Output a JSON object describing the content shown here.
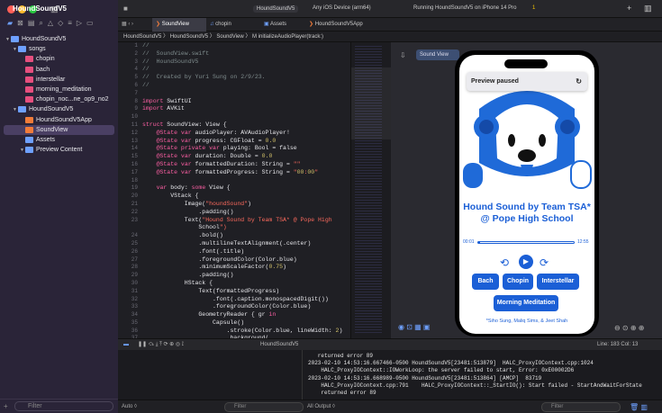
{
  "project_title": "HoundSoundV5",
  "toolbar": {
    "scheme": "HoundSoundV5",
    "device": "Any iOS Device (arm64)",
    "status": "Running HoundSoundV5 on iPhone 14 Pro",
    "warnings": "1"
  },
  "tabs": [
    "SoundView",
    "chopin",
    "Assets",
    "HoundSoundV5App"
  ],
  "breadcrumb": "HoundSoundV5 〉 HoundSoundV5 〉 SoundView 〉 M initializeAudioPlayer(track:)",
  "navigator": [
    {
      "label": "HoundSoundV5",
      "depth": 0,
      "kind": "project"
    },
    {
      "label": "songs",
      "depth": 1,
      "kind": "folder"
    },
    {
      "label": "chopin",
      "depth": 2,
      "kind": "audio"
    },
    {
      "label": "bach",
      "depth": 2,
      "kind": "audio"
    },
    {
      "label": "interstellar",
      "depth": 2,
      "kind": "audio"
    },
    {
      "label": "morning_meditation",
      "depth": 2,
      "kind": "audio"
    },
    {
      "label": "chopin_noc...ne_op9_no2",
      "depth": 2,
      "kind": "audio"
    },
    {
      "label": "HoundSoundV5",
      "depth": 1,
      "kind": "folder"
    },
    {
      "label": "HoundSoundV5App",
      "depth": 2,
      "kind": "swift"
    },
    {
      "label": "SoundView",
      "depth": 2,
      "kind": "swift",
      "selected": true
    },
    {
      "label": "Assets",
      "depth": 2,
      "kind": "assets"
    },
    {
      "label": "Preview Content",
      "depth": 2,
      "kind": "folder"
    }
  ],
  "line_numbers": [
    "1",
    "2",
    "3",
    "4",
    "5",
    "6",
    "7",
    "8",
    "9",
    "10",
    "11",
    "12",
    "13",
    "14",
    "15",
    "16",
    "17",
    "18",
    "19",
    "20",
    "21",
    "22",
    "23",
    "",
    "24",
    "25",
    "26",
    "27",
    "28",
    "29",
    "30",
    "31",
    "32",
    "33",
    "34",
    "35",
    "36",
    "37"
  ],
  "code_lines": [
    "//",
    "//  SoundView.swift",
    "//  HoundSoundV5",
    "//",
    "//  Created by Yuri Sung on 2/9/23.",
    "//",
    "",
    "import SwiftUI",
    "import AVKit",
    "",
    "struct SoundView: View {",
    "    @State var audioPlayer: AVAudioPlayer!",
    "    @State var progress: CGFloat = 0.0",
    "    @State private var playing: Bool = false",
    "    @State var duration: Double = 0.0",
    "    @State var formattedDuration: String = \"\"",
    "    @State var formattedProgress: String = \"00:00\"",
    "",
    "    var body: some View {",
    "        VStack {",
    "            Image(\"houndSound\")",
    "                .padding()",
    "            Text(\"Hound Sound by Team TSA* @ Pope High",
    "                School\")",
    "                .bold()",
    "                .multilineTextAlignment(.center)",
    "                .font(.title)",
    "                .foregroundColor(Color.blue)",
    "                .minimumScaleFactor(0.75)",
    "                .padding()",
    "            HStack {",
    "                Text(formattedProgress)",
    "                    .font(.caption.monospacedDigit())",
    "                    .foregroundColor(Color.blue)",
    "                GeometryReader { gr in",
    "                    Capsule()",
    "                        .stroke(Color.blue, lineWidth: 2)",
    "                        .background("
  ],
  "preview": {
    "pill": "Sound View",
    "paused": "Preview paused",
    "title": "Hound Sound by Team TSA* @ Pope High School",
    "time_start": "00:01",
    "time_end": "12:55",
    "progress": 0.02,
    "buttons": [
      "Bach",
      "Chopin",
      "Interstellar",
      "Morning Meditation"
    ],
    "credits": "*Siho Sung, Maliq Sims, & Jeet Shah"
  },
  "debug": {
    "target": "HoundSoundV5",
    "position": "Line: 183  Col: 13"
  },
  "console_lines": [
    "   returned error 89",
    "2023-02-10 14:53:16.667466-0500 HoundSoundV5[23481:513879]  HALC_ProxyIOContext.cpp:1024",
    "    HALC_ProxyIOContext::IOWorkLoop: the server failed to start, Error: 0xE00002D6",
    "2023-02-10 14:53:16.668989-0500 HoundSoundV5[23481:513864] [AMCP]  83719",
    "    HALC_ProxyIOContext.cpp:791    HALC_ProxyIOContext::_StartIO(): Start failed - StartAndWaitForState",
    "    returned error 89"
  ],
  "bottom": {
    "filter": "Filter",
    "auto": "Auto ◊",
    "all_output": "All Output ◊"
  },
  "colors": {
    "accent": "#1b5fd6",
    "sidebar": "#2a2438"
  }
}
